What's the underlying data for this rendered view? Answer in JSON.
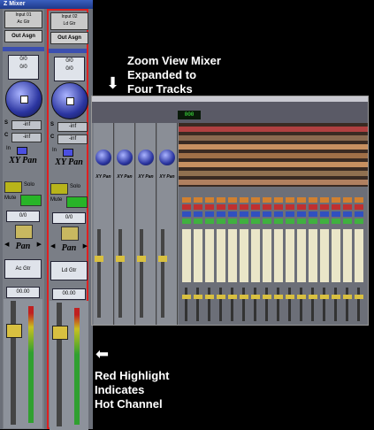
{
  "zoom_mixer": {
    "title": "Z Mixer",
    "strips": [
      {
        "input_label": "Input 01",
        "input_sub": "Ac Gtr",
        "output_button": "Out Asgn",
        "db_display": [
          "0/0",
          "0/0"
        ],
        "send_s": "-inf",
        "send_c": "-inf",
        "in_label": "In",
        "xy_pan": "XY Pan",
        "solo": "Solo",
        "mute": "Mute",
        "pan_value": "0/0",
        "pan_label": "Pan",
        "track_name": "Ac Gtr",
        "volume": "00.00",
        "highlighted": false
      },
      {
        "input_label": "Input 02",
        "input_sub": "Ld Gtr",
        "output_button": "Out Asgn",
        "db_display": [
          "0/0",
          "0/0"
        ],
        "send_s": "-inf",
        "send_c": "-inf",
        "in_label": "In",
        "xy_pan": "XY Pan",
        "solo": "Solo",
        "mute": "Mute",
        "pan_value": "0/0",
        "pan_label": "Pan",
        "track_name": "Ld Gtr",
        "volume": "00.00",
        "highlighted": true
      }
    ]
  },
  "annotations": {
    "zoom_note": [
      "Zoom View Mixer",
      "Expanded to",
      "Four Tracks"
    ],
    "highlight_note": [
      "Red Highlight",
      "Indicates",
      "Hot Channel"
    ]
  },
  "daw": {
    "counter": "000",
    "mini_strip_label": "XY Pan",
    "colors": {
      "highlight": "#e02020",
      "knob": "#2b35a0",
      "mute": "#28b428",
      "solo": "#b8b41a"
    }
  }
}
